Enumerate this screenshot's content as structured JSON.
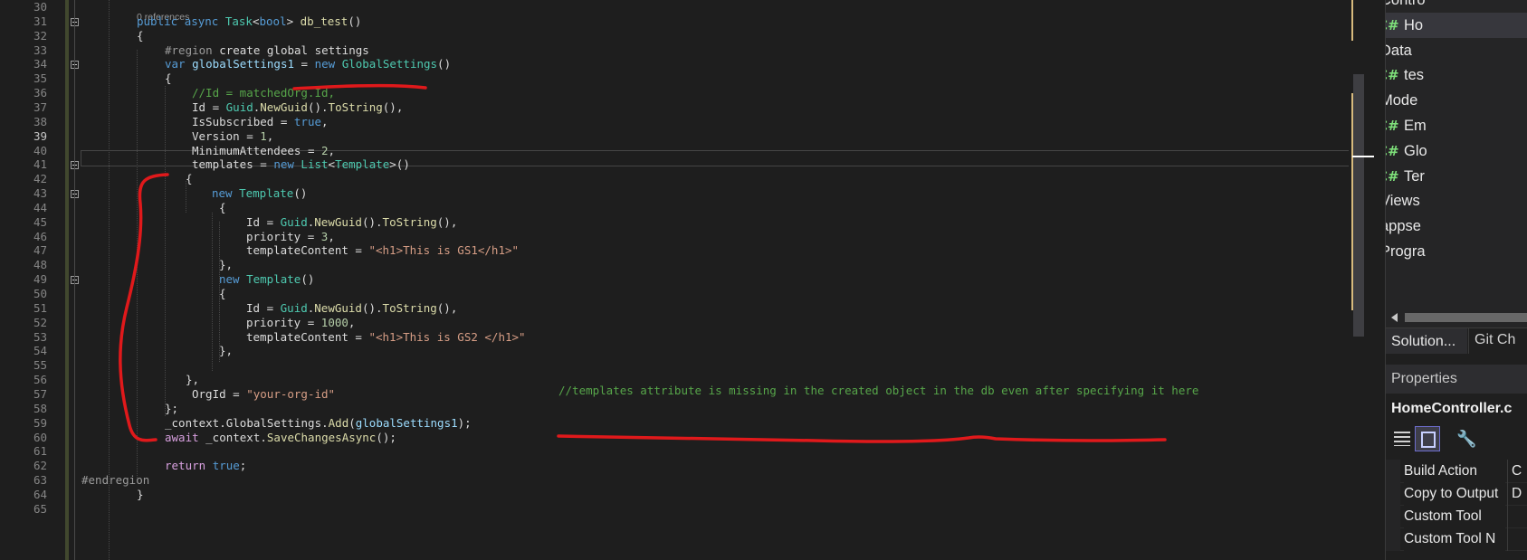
{
  "editor": {
    "codelens": "0 references",
    "current_line": "39",
    "lines": [
      {
        "n": "30",
        "tokens": []
      },
      {
        "n": "31",
        "indent": 151,
        "tokens": [
          [
            "kw",
            "public "
          ],
          [
            "kw",
            "async "
          ],
          [
            "ty",
            "Task"
          ],
          [
            "pun",
            "<"
          ],
          [
            "kw",
            "bool"
          ],
          [
            "pun",
            "> "
          ],
          [
            "fn",
            "db_test"
          ],
          [
            "pun",
            "()"
          ]
        ]
      },
      {
        "n": "32",
        "indent": 151,
        "tokens": [
          [
            "pun",
            "{"
          ]
        ]
      },
      {
        "n": "33",
        "indent": 182,
        "tokens": [
          [
            "pre",
            "#region "
          ],
          [
            "prop",
            "create global settings"
          ]
        ]
      },
      {
        "n": "34",
        "indent": 182,
        "tokens": [
          [
            "kw",
            "var "
          ],
          [
            "var",
            "globalSettings1"
          ],
          [
            "pun",
            " = "
          ],
          [
            "kw",
            "new "
          ],
          [
            "ty",
            "GlobalSettings"
          ],
          [
            "pun",
            "()"
          ]
        ]
      },
      {
        "n": "35",
        "indent": 182,
        "tokens": [
          [
            "pun",
            "{"
          ]
        ]
      },
      {
        "n": "36",
        "indent": 212,
        "tokens": [
          [
            "cm",
            "//Id = matchedOrg.Id,"
          ]
        ]
      },
      {
        "n": "37",
        "indent": 212,
        "tokens": [
          [
            "prop",
            "Id"
          ],
          [
            "pun",
            " = "
          ],
          [
            "ty",
            "Guid"
          ],
          [
            "pun",
            "."
          ],
          [
            "fn",
            "NewGuid"
          ],
          [
            "pun",
            "()."
          ],
          [
            "fn",
            "ToString"
          ],
          [
            "pun",
            "(),"
          ]
        ]
      },
      {
        "n": "38",
        "indent": 212,
        "tokens": [
          [
            "prop",
            "IsSubscribed"
          ],
          [
            "pun",
            " = "
          ],
          [
            "kw",
            "true"
          ],
          [
            "pun",
            ","
          ]
        ]
      },
      {
        "n": "39",
        "indent": 212,
        "tokens": [
          [
            "prop",
            "Version"
          ],
          [
            "pun",
            " = "
          ],
          [
            "num",
            "1"
          ],
          [
            "pun",
            ","
          ]
        ]
      },
      {
        "n": "40",
        "indent": 212,
        "tokens": [
          [
            "prop",
            "MinimumAttendees"
          ],
          [
            "pun",
            " = "
          ],
          [
            "num",
            "2"
          ],
          [
            "pun",
            ","
          ]
        ]
      },
      {
        "n": "41",
        "indent": 212,
        "tokens": [
          [
            "prop",
            "templates"
          ],
          [
            "pun",
            " = "
          ],
          [
            "kw",
            "new "
          ],
          [
            "ty",
            "List"
          ],
          [
            "pun",
            "<"
          ],
          [
            "ty",
            "Template"
          ],
          [
            "pun",
            ">()"
          ]
        ]
      },
      {
        "n": "42",
        "indent": 205,
        "tokens": [
          [
            "pun",
            "{"
          ]
        ]
      },
      {
        "n": "43",
        "indent": 234,
        "tokens": [
          [
            "kw",
            "new "
          ],
          [
            "ty",
            "Template"
          ],
          [
            "pun",
            "()"
          ]
        ]
      },
      {
        "n": "44",
        "indent": 242,
        "tokens": [
          [
            "pun",
            "{"
          ]
        ]
      },
      {
        "n": "45",
        "indent": 272,
        "tokens": [
          [
            "prop",
            "Id"
          ],
          [
            "pun",
            " = "
          ],
          [
            "ty",
            "Guid"
          ],
          [
            "pun",
            "."
          ],
          [
            "fn",
            "NewGuid"
          ],
          [
            "pun",
            "()."
          ],
          [
            "fn",
            "ToString"
          ],
          [
            "pun",
            "(),"
          ]
        ]
      },
      {
        "n": "46",
        "indent": 272,
        "tokens": [
          [
            "prop",
            "priority"
          ],
          [
            "pun",
            " = "
          ],
          [
            "num",
            "3"
          ],
          [
            "pun",
            ","
          ]
        ]
      },
      {
        "n": "47",
        "indent": 272,
        "tokens": [
          [
            "prop",
            "templateContent"
          ],
          [
            "pun",
            " = "
          ],
          [
            "str",
            "\"<h1>This is GS1</h1>\""
          ]
        ]
      },
      {
        "n": "48",
        "indent": 242,
        "tokens": [
          [
            "pun",
            "},"
          ]
        ]
      },
      {
        "n": "49",
        "indent": 242,
        "tokens": [
          [
            "kw",
            "new "
          ],
          [
            "ty",
            "Template"
          ],
          [
            "pun",
            "()"
          ]
        ]
      },
      {
        "n": "50",
        "indent": 242,
        "tokens": [
          [
            "pun",
            "{"
          ]
        ]
      },
      {
        "n": "51",
        "indent": 272,
        "tokens": [
          [
            "prop",
            "Id"
          ],
          [
            "pun",
            " = "
          ],
          [
            "ty",
            "Guid"
          ],
          [
            "pun",
            "."
          ],
          [
            "fn",
            "NewGuid"
          ],
          [
            "pun",
            "()."
          ],
          [
            "fn",
            "ToString"
          ],
          [
            "pun",
            "(),"
          ]
        ]
      },
      {
        "n": "52",
        "indent": 272,
        "tokens": [
          [
            "prop",
            "priority"
          ],
          [
            "pun",
            " = "
          ],
          [
            "num",
            "1000"
          ],
          [
            "pun",
            ","
          ]
        ]
      },
      {
        "n": "53",
        "indent": 272,
        "tokens": [
          [
            "prop",
            "templateContent"
          ],
          [
            "pun",
            " = "
          ],
          [
            "str",
            "\"<h1>This is GS2 </h1>\""
          ]
        ]
      },
      {
        "n": "54",
        "indent": 242,
        "tokens": [
          [
            "pun",
            "},"
          ]
        ]
      },
      {
        "n": "55",
        "indent": 242,
        "tokens": []
      },
      {
        "n": "56",
        "indent": 205,
        "tokens": [
          [
            "pun",
            "},"
          ]
        ]
      },
      {
        "n": "57",
        "indent": 212,
        "tokens": [
          [
            "prop",
            "OrgId"
          ],
          [
            "pun",
            " = "
          ],
          [
            "str",
            "\"your-org-id\""
          ]
        ]
      },
      {
        "n": "58",
        "indent": 182,
        "tokens": [
          [
            "pun",
            "};"
          ]
        ]
      },
      {
        "n": "59",
        "indent": 182,
        "tokens": [
          [
            "prop",
            "_context"
          ],
          [
            "pun",
            "."
          ],
          [
            "prop",
            "GlobalSettings"
          ],
          [
            "pun",
            "."
          ],
          [
            "fn",
            "Add"
          ],
          [
            "pun",
            "("
          ],
          [
            "var",
            "globalSettings1"
          ],
          [
            "pun",
            ");"
          ]
        ]
      },
      {
        "n": "60",
        "indent": 182,
        "tokens": [
          [
            "kw2",
            "await "
          ],
          [
            "prop",
            "_context"
          ],
          [
            "pun",
            "."
          ],
          [
            "fn",
            "SaveChangesAsync"
          ],
          [
            "pun",
            "();"
          ]
        ]
      },
      {
        "n": "61",
        "indent": 182,
        "tokens": []
      },
      {
        "n": "62",
        "indent": 182,
        "tokens": [
          [
            "kw2",
            "return "
          ],
          [
            "kw",
            "true"
          ],
          [
            "pun",
            ";"
          ]
        ]
      },
      {
        "n": "63",
        "indent": 90,
        "tokens": [
          [
            "pre",
            "#endregion"
          ]
        ]
      },
      {
        "n": "64",
        "indent": 151,
        "tokens": [
          [
            "pun",
            "}"
          ]
        ]
      },
      {
        "n": "65",
        "tokens": []
      }
    ],
    "annotation_comment": "//templates attribute is missing in the created object in the db even after specifying it here"
  },
  "solution_explorer": {
    "items": [
      {
        "label": "Contro",
        "kind": "folder",
        "arrow": "open"
      },
      {
        "label": "Ho",
        "kind": "cs",
        "arrow": "closed",
        "selected": true
      },
      {
        "label": "Data",
        "kind": "folder",
        "arrow": "open"
      },
      {
        "label": "tes",
        "kind": "cs",
        "arrow": "closed"
      },
      {
        "label": "Mode",
        "kind": "folder",
        "arrow": "open"
      },
      {
        "label": "Em",
        "kind": "cs",
        "arrow": "closed"
      },
      {
        "label": "Glo",
        "kind": "cs",
        "arrow": "closed"
      },
      {
        "label": "Ter",
        "kind": "cs",
        "arrow": "closed"
      },
      {
        "label": "Views",
        "kind": "folder",
        "arrow": "closed"
      },
      {
        "label": "appse",
        "kind": "json",
        "arrow": "closed"
      },
      {
        "label": "Progra",
        "kind": "cs",
        "arrow": "closed"
      }
    ],
    "cs_glyph": "C#",
    "json_glyph": "{ }"
  },
  "tabs": {
    "solution": "Solution...",
    "git": "Git Ch"
  },
  "properties": {
    "header": "Properties",
    "object": "HomeController.c",
    "rows": [
      {
        "name": "Build Action",
        "value": "C"
      },
      {
        "name": "Copy to Output",
        "value": "D"
      },
      {
        "name": "Custom Tool",
        "value": ""
      },
      {
        "name": "Custom Tool N",
        "value": ""
      }
    ],
    "wrench_glyph": "🔧"
  },
  "colors": {
    "annotation_red": "#e0191b",
    "accent": "#d7ba7d"
  }
}
